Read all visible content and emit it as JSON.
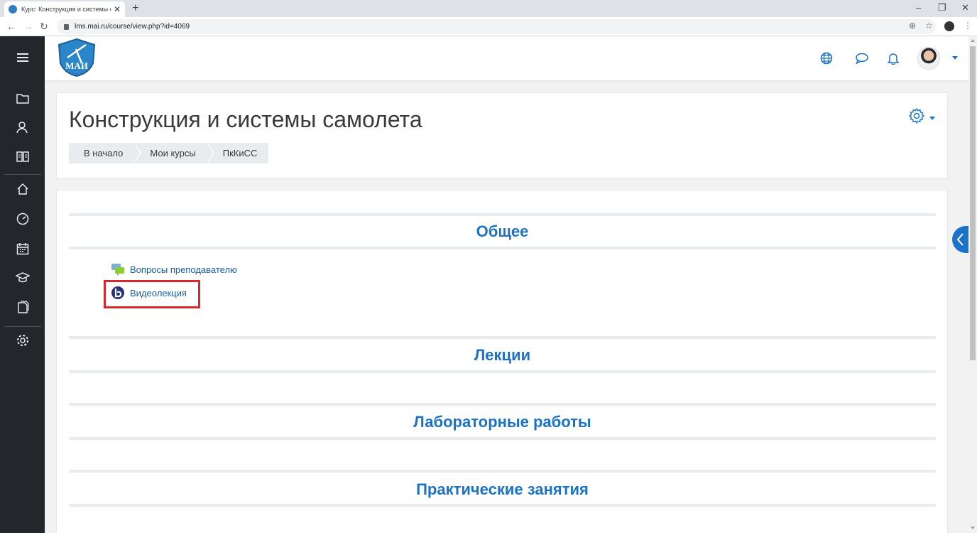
{
  "browser": {
    "tab_title": "Курс: Конструкция и системы с",
    "url": "lms.mai.ru/course/view.php?id=4069"
  },
  "header": {
    "logo_text": "МАИ",
    "icons": [
      "language-icon",
      "messages-icon",
      "notifications-icon"
    ]
  },
  "page": {
    "title": "Конструкция и системы самолета",
    "breadcrumbs": [
      "В начало",
      "Мои курсы",
      "ПкКиСС"
    ]
  },
  "sections": [
    {
      "title": "Общее"
    },
    {
      "title": "Лекции"
    },
    {
      "title": "Лабораторные работы"
    },
    {
      "title": "Практические занятия"
    }
  ],
  "activities": [
    {
      "label": "Вопросы преподавателю",
      "icon": "forum-icon"
    },
    {
      "label": "Видеолекция",
      "icon": "bigbluebutton-icon"
    }
  ],
  "colors": {
    "accent": "#1a73c8",
    "nav_bg": "#23272c",
    "highlight": "#d9272e"
  }
}
